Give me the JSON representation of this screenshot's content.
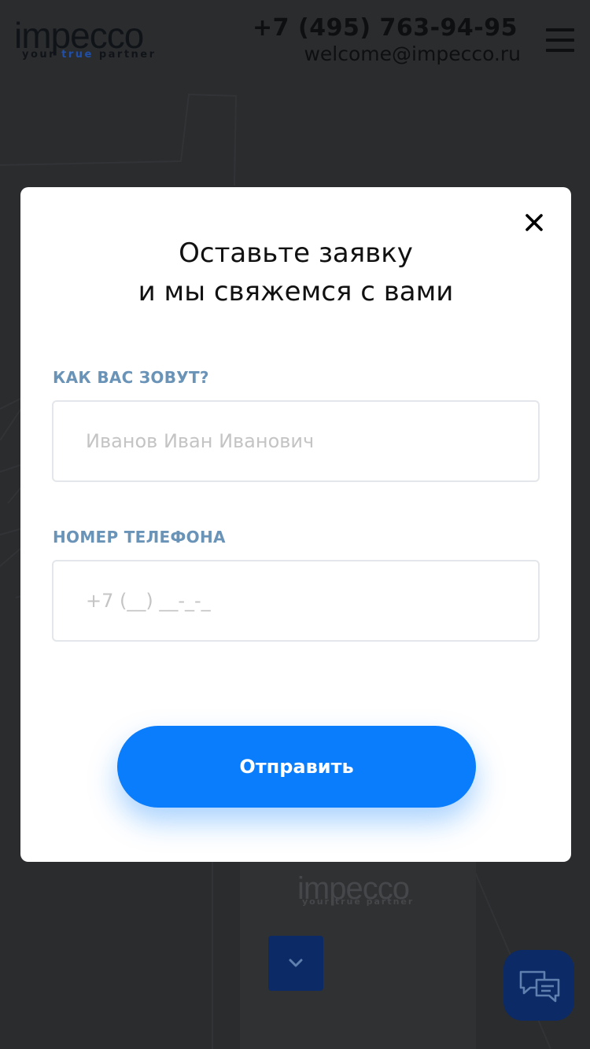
{
  "header": {
    "logo_word": "impecco",
    "logo_tag_a": "your ",
    "logo_tag_b": "true",
    "logo_tag_c": " partner",
    "phone": "+7 (495) 763-94-95",
    "email": "welcome@impecco.ru",
    "menu_icon": "hamburger-menu-icon"
  },
  "modal": {
    "title_line1": "Оставьте заявку",
    "title_line2": "и мы свяжемся с вами",
    "close_icon": "close-icon",
    "name_label": "КАК ВАС ЗОВУТ?",
    "name_placeholder": "Иванов Иван Иванович",
    "name_value": "",
    "phone_label": "НОМЕР ТЕЛЕФОНА",
    "phone_placeholder": "+7 (__) __-_-_",
    "phone_value": "",
    "submit_label": "Отправить"
  },
  "background": {
    "logo_word": "impecco",
    "logo_tag": "your true partner",
    "scroll_icon": "chevron-down-icon",
    "chat_icon": "chat-bubbles-icon"
  },
  "colors": {
    "accent": "#0a7dfc",
    "label": "#6a93b8",
    "dark_button": "#0c2a66",
    "overlay_bg": "#2b2c2e"
  }
}
